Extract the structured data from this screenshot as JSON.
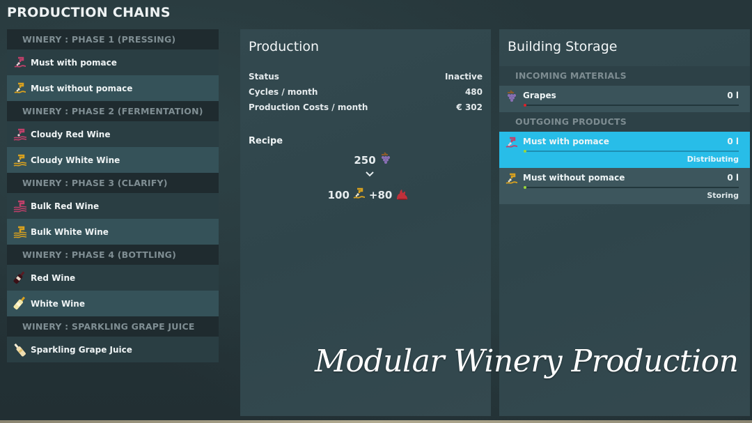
{
  "title": "PRODUCTION CHAINS",
  "chains": [
    {
      "phase": "WINERY : PHASE 1 (PRESSING)",
      "items": [
        {
          "label": "Must with pomace",
          "icon": "must-with-pomace-icon",
          "color": "#c0406a"
        },
        {
          "label": "Must without pomace",
          "icon": "must-without-pomace-icon",
          "color": "#d9a11e"
        }
      ]
    },
    {
      "phase": "WINERY : PHASE 2 (FERMENTATION)",
      "items": [
        {
          "label": "Cloudy Red Wine",
          "icon": "cloudy-red-wine-icon",
          "color": "#c0406a"
        },
        {
          "label": "Cloudy White Wine",
          "icon": "cloudy-white-wine-icon",
          "color": "#d9a11e"
        }
      ]
    },
    {
      "phase": "WINERY : PHASE 3 (CLARIFY)",
      "items": [
        {
          "label": "Bulk Red Wine",
          "icon": "bulk-red-wine-icon",
          "color": "#c0406a"
        },
        {
          "label": "Bulk White Wine",
          "icon": "bulk-white-wine-icon",
          "color": "#d9a11e"
        }
      ]
    },
    {
      "phase": "WINERY : PHASE 4 (BOTTLING)",
      "items": [
        {
          "label": "Red Wine",
          "icon": "red-wine-bottle-icon",
          "color": "#5a1a22"
        },
        {
          "label": "White Wine",
          "icon": "white-wine-bottle-icon",
          "color": "#e8d98a"
        }
      ]
    },
    {
      "phase": "WINERY : SPARKLING GRAPE JUICE",
      "items": [
        {
          "label": "Sparkling Grape Juice",
          "icon": "sparkling-grape-juice-icon",
          "color": "#f0deb0"
        }
      ]
    }
  ],
  "production": {
    "title": "Production",
    "stats": [
      {
        "label": "Status",
        "value": "Inactive"
      },
      {
        "label": "Cycles / month",
        "value": "480"
      },
      {
        "label": "Production Costs / month",
        "value": "€ 302"
      }
    ],
    "recipe": {
      "label": "Recipe",
      "input": {
        "amount": "250",
        "icon": "grapes-icon"
      },
      "arrow": "⌄",
      "output": [
        {
          "amount": "100",
          "icon": "must-without-pomace-icon"
        },
        {
          "amount": "+80",
          "icon": "pomace-icon"
        }
      ]
    }
  },
  "storage": {
    "title": "Building Storage",
    "incoming_header": "INCOMING MATERIALS",
    "incoming": [
      {
        "name": "Grapes",
        "amount": "0 l",
        "fill": 0,
        "indicator_color": "#e0202a"
      }
    ],
    "outgoing_header": "OUTGOING PRODUCTS",
    "outgoing": [
      {
        "name": "Must with pomace",
        "amount": "0 l",
        "mode": "Distributing",
        "fill": 0,
        "selected": true,
        "indicator_color": "#9bd83a"
      },
      {
        "name": "Must without pomace",
        "amount": "0 l",
        "mode": "Storing",
        "fill": 0,
        "selected": false,
        "indicator_color": "#9bd83a"
      }
    ]
  },
  "colors": {
    "selected_row": "#28bde8",
    "red_product": "#c0406a",
    "white_product": "#d9a11e"
  },
  "watermark": "Modular Winery Production"
}
